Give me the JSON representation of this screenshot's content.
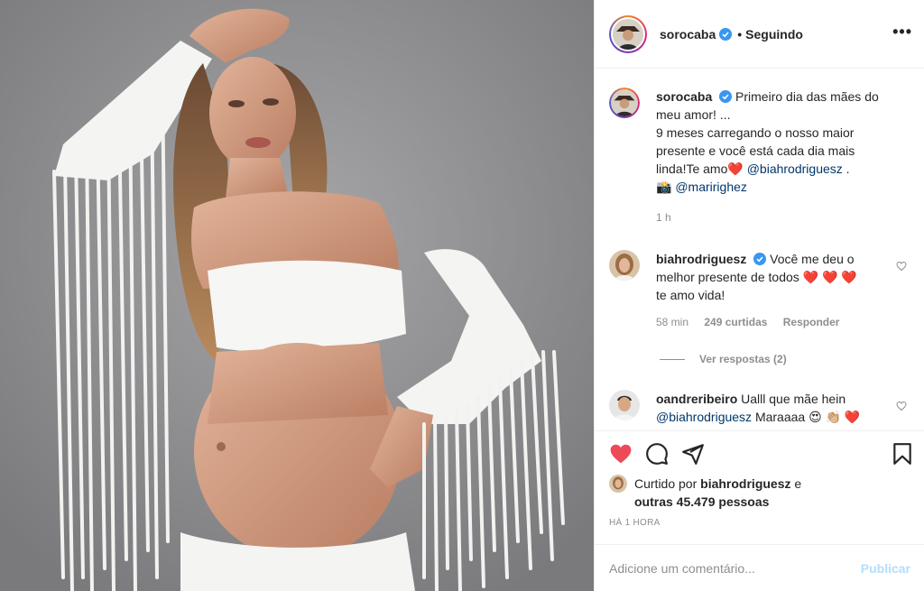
{
  "colors": {
    "brand_blue": "#0095f6",
    "publish_disabled": "#b2dffc",
    "like_red": "#ed4956",
    "muted": "#8e8e8e",
    "text": "#262626",
    "mention": "#00376b"
  },
  "photo": {
    "icon": "post-photo"
  },
  "header": {
    "username": "sorocaba",
    "separator": "•",
    "follow_label": "Seguindo",
    "more_label": "•••"
  },
  "caption": {
    "username": "sorocaba",
    "text_1": "Primeiro dia das mães do meu amor! ...",
    "text_2": "9 meses carregando o nosso maior presente e você está cada dia mais linda!Te amo",
    "heart": "❤️",
    "mention_1": "@biahrodriguesz",
    "period": ".",
    "camera": "📸",
    "mention_2": "@maririghez",
    "time": "1 h"
  },
  "comments": [
    {
      "username": "biahrodriguesz",
      "text": "Você me deu o melhor presente de todos",
      "emojis": "❤️ ❤️ ❤️",
      "text_2": "te amo vida!",
      "time": "58 min",
      "likes": "249 curtidas",
      "reply_label": "Responder"
    },
    {
      "username": "oandreribeiro",
      "text": "Ualll que mãe hein",
      "mention": "@biahrodriguesz",
      "text_2": "Maraaaa",
      "emojis": "😍 👏🏼 ❤️"
    }
  ],
  "view_replies": "Ver respostas (2)",
  "likes": {
    "prefix": "Curtido por",
    "user": "biahrodriguesz",
    "conj": "e",
    "others": "outras 45.479 pessoas"
  },
  "timeago": "HÁ 1 HORA",
  "add_comment": {
    "placeholder": "Adicione um comentário...",
    "publish_label": "Publicar"
  }
}
